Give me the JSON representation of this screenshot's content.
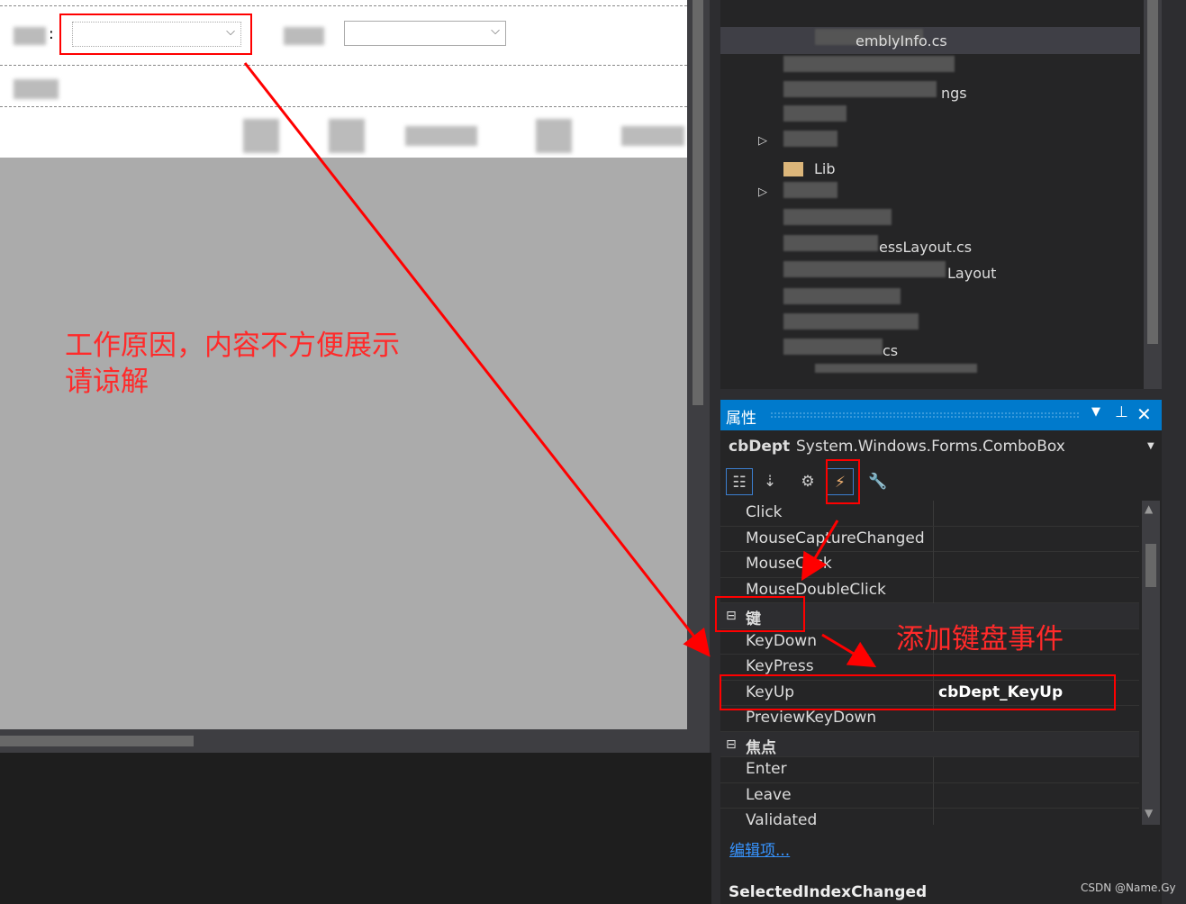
{
  "designer": {
    "label_separator": ":",
    "chevron": "⌵"
  },
  "solution_explorer": {
    "items": [
      "emblyInfo.cs",
      "ngs",
      "Lib",
      "essLayout.cs",
      "Layout",
      "cs"
    ],
    "expand_glyph": "▷"
  },
  "properties": {
    "title": "属性",
    "object_name": "cbDept",
    "object_type": "System.Windows.Forms.ComboBox",
    "rows": [
      {
        "name": "Click",
        "value": ""
      },
      {
        "name": "MouseCaptureChanged",
        "value": ""
      },
      {
        "name": "MouseClick",
        "value": ""
      },
      {
        "name": "MouseDoubleClick",
        "value": ""
      },
      {
        "category": "键"
      },
      {
        "name": "KeyDown",
        "value": ""
      },
      {
        "name": "KeyPress",
        "value": ""
      },
      {
        "name": "KeyUp",
        "value": "cbDept_KeyUp"
      },
      {
        "name": "PreviewKeyDown",
        "value": ""
      },
      {
        "category": "焦点"
      },
      {
        "name": "Enter",
        "value": ""
      },
      {
        "name": "Leave",
        "value": ""
      },
      {
        "name": "Validated",
        "value": ""
      }
    ],
    "edit_items_link": "编辑项...",
    "description_title": "SelectedIndexChanged"
  },
  "annotations": {
    "note1_line1": "工作原因，内容不方便展示",
    "note1_line2": "请谅解",
    "note2": "添加键盘事件",
    "color": "#ff2a2a"
  },
  "watermark": "CSDN @Name.Gy"
}
